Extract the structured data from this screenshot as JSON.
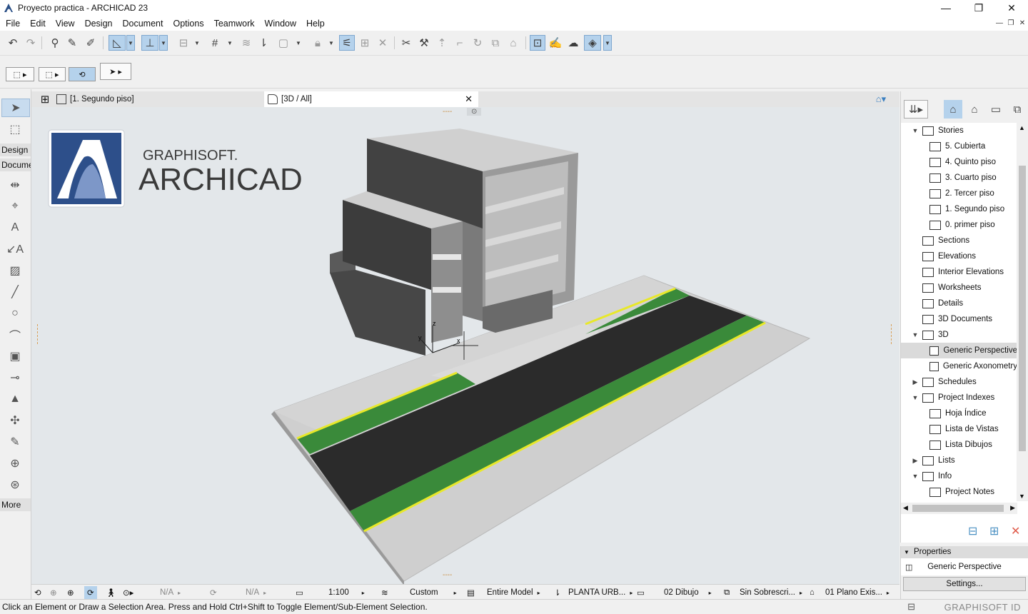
{
  "window": {
    "title": "Proyecto practica - ARCHICAD 23",
    "controls": [
      "—",
      "❐",
      "✕"
    ]
  },
  "menu": [
    "File",
    "Edit",
    "View",
    "Design",
    "Document",
    "Options",
    "Teamwork",
    "Window",
    "Help"
  ],
  "mdi_controls": [
    "—",
    "❐",
    "✕"
  ],
  "toolbox": {
    "groups": {
      "design": "Design",
      "document": "Docume",
      "more": "More"
    }
  },
  "tabs": [
    {
      "label": "[1. Segundo piso]",
      "active": false
    },
    {
      "label": "[3D / All]",
      "active": true
    }
  ],
  "viewport": {
    "brand_line1": "GRAPHISOFT.",
    "brand_line2": "ARCHICAD",
    "axis_labels": {
      "z": "z",
      "y": "y",
      "x": "x"
    },
    "colors": {
      "background": "#e3e7ea",
      "walls": "#4a4a4a",
      "slabs": "#c9c9c9",
      "road": "#2b2b2b",
      "grass": "#3a8a3a",
      "curb": "#e8e82a",
      "paving": "#cfcfcf"
    }
  },
  "navigator": {
    "items": [
      {
        "label": "Stories",
        "level": 0,
        "twisty": "open",
        "icon": "stories-icon"
      },
      {
        "label": "5. Cubierta",
        "level": 1,
        "icon": "story-icon"
      },
      {
        "label": "4. Quinto piso",
        "level": 1,
        "icon": "story-icon"
      },
      {
        "label": "3. Cuarto piso",
        "level": 1,
        "icon": "story-icon"
      },
      {
        "label": "2. Tercer piso",
        "level": 1,
        "icon": "story-icon"
      },
      {
        "label": "1. Segundo piso",
        "level": 1,
        "icon": "story-icon"
      },
      {
        "label": "0. primer piso",
        "level": 1,
        "icon": "story-icon"
      },
      {
        "label": "Sections",
        "level": 0,
        "icon": "sections-icon"
      },
      {
        "label": "Elevations",
        "level": 0,
        "icon": "elevations-icon"
      },
      {
        "label": "Interior Elevations",
        "level": 0,
        "icon": "interior-elevations-icon"
      },
      {
        "label": "Worksheets",
        "level": 0,
        "icon": "worksheets-icon"
      },
      {
        "label": "Details",
        "level": 0,
        "icon": "details-icon"
      },
      {
        "label": "3D Documents",
        "level": 0,
        "icon": "3d-documents-icon"
      },
      {
        "label": "3D",
        "level": 0,
        "twisty": "open",
        "icon": "3d-icon"
      },
      {
        "label": "Generic Perspective",
        "level": 1,
        "icon": "perspective-icon",
        "selected": true
      },
      {
        "label": "Generic Axonometry",
        "level": 1,
        "icon": "axonometry-icon"
      },
      {
        "label": "Schedules",
        "level": 0,
        "twisty": "closed",
        "icon": "schedules-icon"
      },
      {
        "label": "Project Indexes",
        "level": 0,
        "twisty": "open",
        "icon": "project-indexes-icon"
      },
      {
        "label": "Hoja Índice",
        "level": 1,
        "icon": "index-icon"
      },
      {
        "label": "Lista de Vistas",
        "level": 1,
        "icon": "index-icon"
      },
      {
        "label": "Lista Dibujos",
        "level": 1,
        "icon": "index-icon"
      },
      {
        "label": "Lists",
        "level": 0,
        "twisty": "closed",
        "icon": "lists-icon"
      },
      {
        "label": "Info",
        "level": 0,
        "twisty": "open",
        "icon": "info-icon"
      },
      {
        "label": "Project Notes",
        "level": 1,
        "icon": "notes-icon"
      }
    ]
  },
  "properties": {
    "header": "Properties",
    "view_name": "Generic Perspective",
    "settings_button": "Settings..."
  },
  "quick_options": {
    "zoom_na1": "N/A",
    "zoom_na2": "N/A",
    "scale": "1:100",
    "dimension": "Custom",
    "model_filter": "Entire Model",
    "layer_combo": "PLANTA URB...",
    "pen_set": "02 Dibujo",
    "override": "Sin Sobrescri...",
    "renovation": "01 Plano Exis..."
  },
  "status": {
    "message": "Click an Element or Draw a Selection Area. Press and Hold Ctrl+Shift to Toggle Element/Sub-Element Selection.",
    "graphisoft_id": "GRAPHISOFT ID"
  }
}
